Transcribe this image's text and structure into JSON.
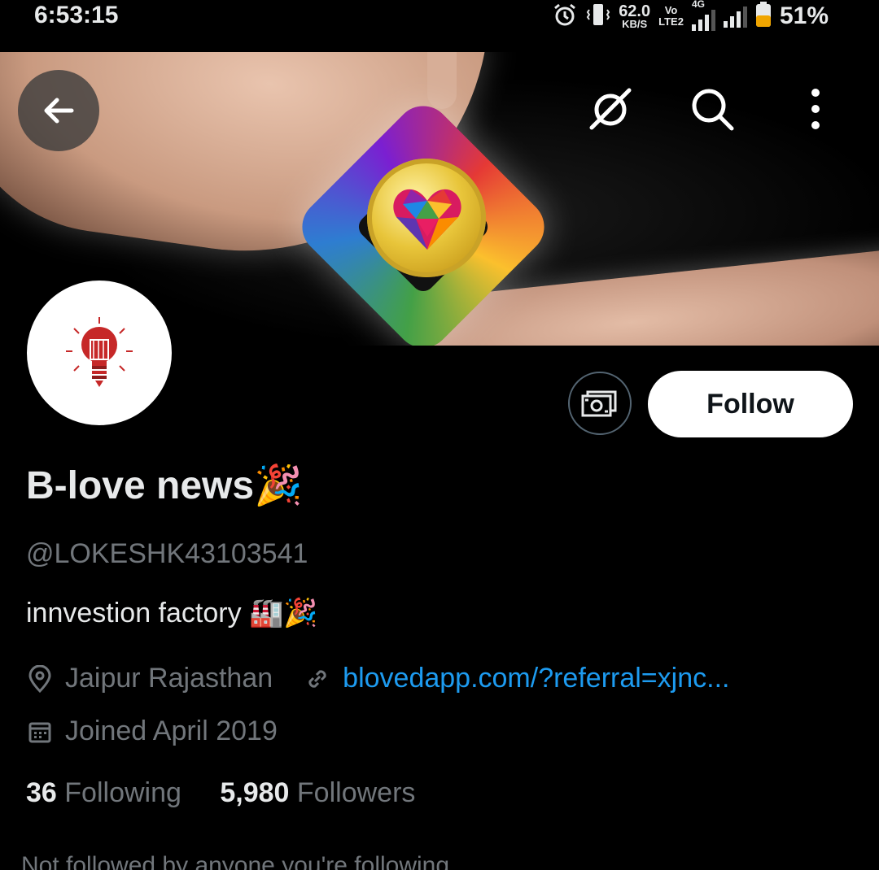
{
  "status_bar": {
    "time": "6:53:15",
    "net_speed_value": "62.0",
    "net_speed_unit": "KB/S",
    "volte_top": "Vo",
    "volte_bottom": "LTE2",
    "network_type": "4G",
    "battery": "51%"
  },
  "header": {
    "back_icon": "arrow-left-icon",
    "icons": [
      "grok-icon",
      "search-icon",
      "more-vertical-icon"
    ]
  },
  "profile": {
    "name": "B-love news",
    "name_emoji": "🎉",
    "handle": "@LOKESHK43103541",
    "bio": "innvestion factory ",
    "bio_emoji": "🏭🎉",
    "location": "Jaipur Rajasthan",
    "website": "blovedapp.com/?referral=xjnc...",
    "joined": "Joined April 2019",
    "following_count": "36",
    "following_label": "Following",
    "followers_count": "5,980",
    "followers_label": "Followers",
    "not_followed": "Not followed by anyone you're following"
  },
  "actions": {
    "follow_label": "Follow"
  },
  "colors": {
    "background": "#000000",
    "link": "#1d9bf0",
    "muted": "#71767b",
    "battery": "#f0a500"
  }
}
